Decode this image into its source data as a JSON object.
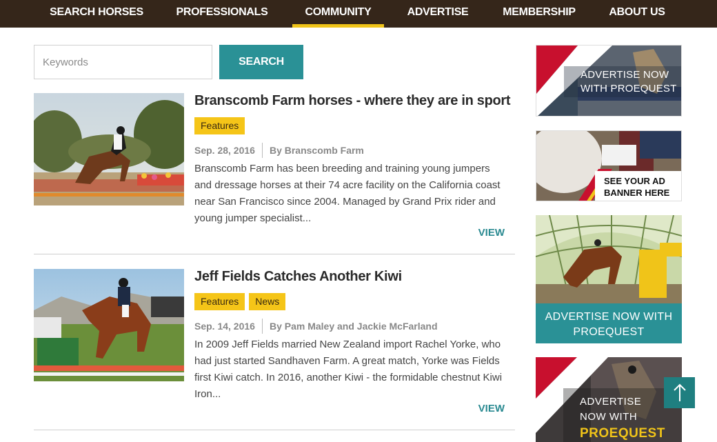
{
  "nav": {
    "items": [
      {
        "label": "SEARCH HORSES"
      },
      {
        "label": "PROFESSIONALS"
      },
      {
        "label": "COMMUNITY",
        "active": true
      },
      {
        "label": "ADVERTISE"
      },
      {
        "label": "MEMBERSHIP"
      },
      {
        "label": "ABOUT US"
      }
    ]
  },
  "search": {
    "placeholder": "Keywords",
    "value": "",
    "button_label": "SEARCH"
  },
  "articles": [
    {
      "title": "Branscomb Farm horses - where they are in sport",
      "tags": [
        "Features"
      ],
      "date": "Sep. 28, 2016",
      "author": "By Branscomb Farm",
      "excerpt": "Branscomb Farm has been breeding and training young jumpers and dressage horses at their 74 acre facility on the California coast near San Francisco since 2004. Managed by Grand Prix rider and young jumper specialist...",
      "view_label": "VIEW"
    },
    {
      "title": "Jeff Fields Catches Another Kiwi",
      "tags": [
        "Features",
        "News"
      ],
      "date": "Sep. 14, 2016",
      "author": "By Pam Maley and Jackie McFarland",
      "excerpt": "In 2009 Jeff Fields married New Zealand import Rachel Yorke, who had just started Sandhaven Farm. A great match, Yorke was Fields first Kiwi catch. In 2016, another Kiwi - the formidable chestnut Kiwi Iron...",
      "view_label": "VIEW"
    }
  ],
  "sidebar": {
    "ads": [
      {
        "line1": "ADVERTISE NOW",
        "line2": "WITH PROEQUEST"
      },
      {
        "line1": "SEE YOUR AD",
        "line2": "BANNER HERE"
      },
      {
        "line1": "ADVERTISE NOW WITH",
        "line2": "PROEQUEST"
      },
      {
        "line1": "ADVERTISE",
        "line2": "NOW WITH",
        "line3": "PROEQUEST"
      }
    ]
  },
  "colors": {
    "nav_bg": "#35261a",
    "accent_yellow": "#f5c518",
    "teal": "#2a9196",
    "brand_red": "#c8102e"
  },
  "icons": {
    "scroll_top": "arrow-up-icon"
  }
}
